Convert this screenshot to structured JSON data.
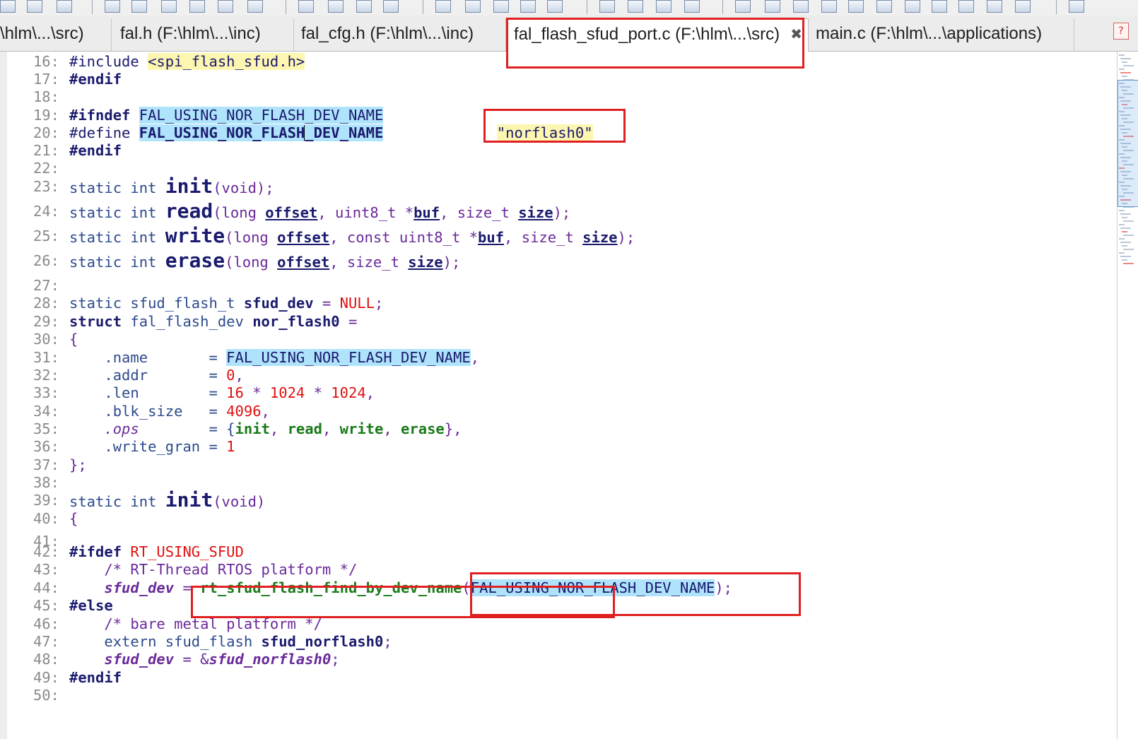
{
  "tabs": [
    {
      "label": "\\hlm\\...\\src)",
      "active": false
    },
    {
      "label": "fal.h (F:\\hlm\\...\\inc)",
      "active": false
    },
    {
      "label": "fal_cfg.h (F:\\hlm\\...\\inc)",
      "active": false
    },
    {
      "label": "fal_flash_sfud_port.c (F:\\hlm\\...\\src)",
      "active": true
    },
    {
      "label": "main.c (F:\\hlm\\...\\applications)",
      "active": false
    }
  ],
  "tab_close_glyph": "✖",
  "colors": {
    "annotation": "#e02020",
    "highlight": "#aee3fb",
    "string_bg": "#fdf6b0"
  },
  "code": {
    "lines": [
      {
        "n": "16:",
        "tokens": [
          {
            "t": "#include ",
            "c": "pp"
          },
          {
            "t": "<spi_flash_sfud.h>",
            "c": "str"
          }
        ]
      },
      {
        "n": "17:",
        "tokens": [
          {
            "t": "#endif",
            "c": "ppb"
          }
        ]
      },
      {
        "n": "18:",
        "tokens": []
      },
      {
        "n": "19:",
        "tokens": [
          {
            "t": "#ifndef ",
            "c": "ppb"
          },
          {
            "t": "FAL_USING_NOR_FLASH_DEV_NAME",
            "c": "pp hl"
          }
        ]
      },
      {
        "n": "20:",
        "tokens": [
          {
            "t": "#define ",
            "c": "pp"
          },
          {
            "t": "FAL_USING_NOR_FLASH",
            "c": "var hl"
          },
          {
            "t": "caret",
            "c": "caret"
          },
          {
            "t": "_DEV_NAME",
            "c": "var hl"
          },
          {
            "t": "             ",
            "c": ""
          },
          {
            "t": "\"norflash0\"",
            "c": "str"
          }
        ]
      },
      {
        "n": "21:",
        "tokens": [
          {
            "t": "#endif",
            "c": "ppb"
          }
        ]
      },
      {
        "n": "22:",
        "tokens": []
      },
      {
        "n": "23:",
        "tokens": [
          {
            "t": "static int ",
            "c": "kw"
          },
          {
            "t": "init",
            "c": "fnbig"
          },
          {
            "t": "(void);",
            "c": "op"
          }
        ]
      },
      {
        "n": "24:",
        "tokens": [
          {
            "t": "static int ",
            "c": "kw"
          },
          {
            "t": "read",
            "c": "fnbig"
          },
          {
            "t": "(long ",
            "c": "op"
          },
          {
            "t": "offset",
            "c": "param"
          },
          {
            "t": ", uint8_t *",
            "c": "op"
          },
          {
            "t": "buf",
            "c": "param"
          },
          {
            "t": ", size_t ",
            "c": "op"
          },
          {
            "t": "size",
            "c": "param"
          },
          {
            "t": ");",
            "c": "op"
          }
        ]
      },
      {
        "n": "25:",
        "tokens": [
          {
            "t": "static int ",
            "c": "kw"
          },
          {
            "t": "write",
            "c": "fnbig"
          },
          {
            "t": "(long ",
            "c": "op"
          },
          {
            "t": "offset",
            "c": "param"
          },
          {
            "t": ", const uint8_t *",
            "c": "op"
          },
          {
            "t": "buf",
            "c": "param"
          },
          {
            "t": ", size_t ",
            "c": "op"
          },
          {
            "t": "size",
            "c": "param"
          },
          {
            "t": ");",
            "c": "op"
          }
        ]
      },
      {
        "n": "26:",
        "tokens": [
          {
            "t": "static int ",
            "c": "kw"
          },
          {
            "t": "erase",
            "c": "fnbig"
          },
          {
            "t": "(long ",
            "c": "op"
          },
          {
            "t": "offset",
            "c": "param"
          },
          {
            "t": ", size_t ",
            "c": "op"
          },
          {
            "t": "size",
            "c": "param"
          },
          {
            "t": ");",
            "c": "op"
          }
        ]
      },
      {
        "n": "27:",
        "tokens": []
      },
      {
        "n": "28:",
        "tokens": [
          {
            "t": "static sfud_flash_t ",
            "c": "kw"
          },
          {
            "t": "sfud_dev",
            "c": "var"
          },
          {
            "t": " = ",
            "c": "op"
          },
          {
            "t": "NULL",
            "c": "red"
          },
          {
            "t": ";",
            "c": "op"
          }
        ]
      },
      {
        "n": "29:",
        "tokens": [
          {
            "t": "struct ",
            "c": "ppb"
          },
          {
            "t": "fal_flash_dev ",
            "c": "kw"
          },
          {
            "t": "nor_flash0",
            "c": "var"
          },
          {
            "t": " =",
            "c": "op"
          }
        ]
      },
      {
        "n": "30:",
        "tokens": [
          {
            "t": "{",
            "c": "op"
          }
        ]
      },
      {
        "n": "31:",
        "tokens": [
          {
            "t": "    .name       = ",
            "c": "mem"
          },
          {
            "t": "FAL_USING_NOR_FLASH_DEV_NAME",
            "c": "pp hl"
          },
          {
            "t": ",",
            "c": "op"
          }
        ]
      },
      {
        "n": "32:",
        "tokens": [
          {
            "t": "    .addr       = ",
            "c": "mem"
          },
          {
            "t": "0",
            "c": "num"
          },
          {
            "t": ",",
            "c": "op"
          }
        ]
      },
      {
        "n": "33:",
        "tokens": [
          {
            "t": "    .len        = ",
            "c": "mem"
          },
          {
            "t": "16",
            "c": "num"
          },
          {
            "t": " * ",
            "c": "op"
          },
          {
            "t": "1024",
            "c": "num"
          },
          {
            "t": " * ",
            "c": "op"
          },
          {
            "t": "1024",
            "c": "num"
          },
          {
            "t": ",",
            "c": "op"
          }
        ]
      },
      {
        "n": "34:",
        "tokens": [
          {
            "t": "    .blk_size   = ",
            "c": "mem"
          },
          {
            "t": "4096",
            "c": "num"
          },
          {
            "t": ",",
            "c": "op"
          }
        ]
      },
      {
        "n": "35:",
        "tokens": [
          {
            "t": "    ",
            "c": ""
          },
          {
            "t": ".ops",
            "c": "mem-it"
          },
          {
            "t": "        = {",
            "c": "mem"
          },
          {
            "t": "init",
            "c": "fn"
          },
          {
            "t": ", ",
            "c": "op"
          },
          {
            "t": "read",
            "c": "fn"
          },
          {
            "t": ", ",
            "c": "op"
          },
          {
            "t": "write",
            "c": "fn"
          },
          {
            "t": ", ",
            "c": "op"
          },
          {
            "t": "erase",
            "c": "fn"
          },
          {
            "t": "},",
            "c": "op"
          }
        ]
      },
      {
        "n": "36:",
        "tokens": [
          {
            "t": "    .write_gran = ",
            "c": "mem"
          },
          {
            "t": "1",
            "c": "num"
          }
        ]
      },
      {
        "n": "37:",
        "tokens": [
          {
            "t": "};",
            "c": "op"
          }
        ]
      },
      {
        "n": "38:",
        "tokens": []
      },
      {
        "n": "39:",
        "tokens": [
          {
            "t": "static int ",
            "c": "kw"
          },
          {
            "t": "init",
            "c": "fnbig"
          },
          {
            "t": "(void)",
            "c": "op"
          }
        ]
      },
      {
        "n": "40:",
        "tokens": [
          {
            "t": "{",
            "c": "op"
          }
        ]
      },
      {
        "n": "41:",
        "tokens": []
      },
      {
        "n": "42:",
        "tokens": [
          {
            "t": "#ifdef ",
            "c": "ppb"
          },
          {
            "t": "RT_USING_SFUD",
            "c": "red"
          }
        ]
      },
      {
        "n": "43:",
        "tokens": [
          {
            "t": "    /* RT-Thread RTOS platform */",
            "c": "cmt"
          }
        ]
      },
      {
        "n": "44:",
        "tokens": [
          {
            "t": "    ",
            "c": ""
          },
          {
            "t": "sfud_dev",
            "c": "ital"
          },
          {
            "t": " = ",
            "c": "op"
          },
          {
            "t": "rt_sfud_flash_find_by_dev_name",
            "c": "fn"
          },
          {
            "t": "(",
            "c": "op"
          },
          {
            "t": "FAL_USING_NOR_FLASH_DEV_NAME",
            "c": "pp hl"
          },
          {
            "t": ");",
            "c": "op"
          }
        ]
      },
      {
        "n": "45:",
        "tokens": [
          {
            "t": "#else",
            "c": "ppb"
          }
        ]
      },
      {
        "n": "46:",
        "tokens": [
          {
            "t": "    /* bare metal platform */",
            "c": "cmt"
          }
        ]
      },
      {
        "n": "47:",
        "tokens": [
          {
            "t": "    extern sfud_flash ",
            "c": "kw"
          },
          {
            "t": "sfud_norflash0",
            "c": "var"
          },
          {
            "t": ";",
            "c": "op"
          }
        ]
      },
      {
        "n": "48:",
        "tokens": [
          {
            "t": "    ",
            "c": ""
          },
          {
            "t": "sfud_dev",
            "c": "ital"
          },
          {
            "t": " = &",
            "c": "op"
          },
          {
            "t": "sfud_norflash0",
            "c": "ital"
          },
          {
            "t": ";",
            "c": "op"
          }
        ]
      },
      {
        "n": "49:",
        "tokens": [
          {
            "t": "#endif",
            "c": "ppb"
          }
        ]
      },
      {
        "n": "50:",
        "tokens": []
      }
    ]
  }
}
